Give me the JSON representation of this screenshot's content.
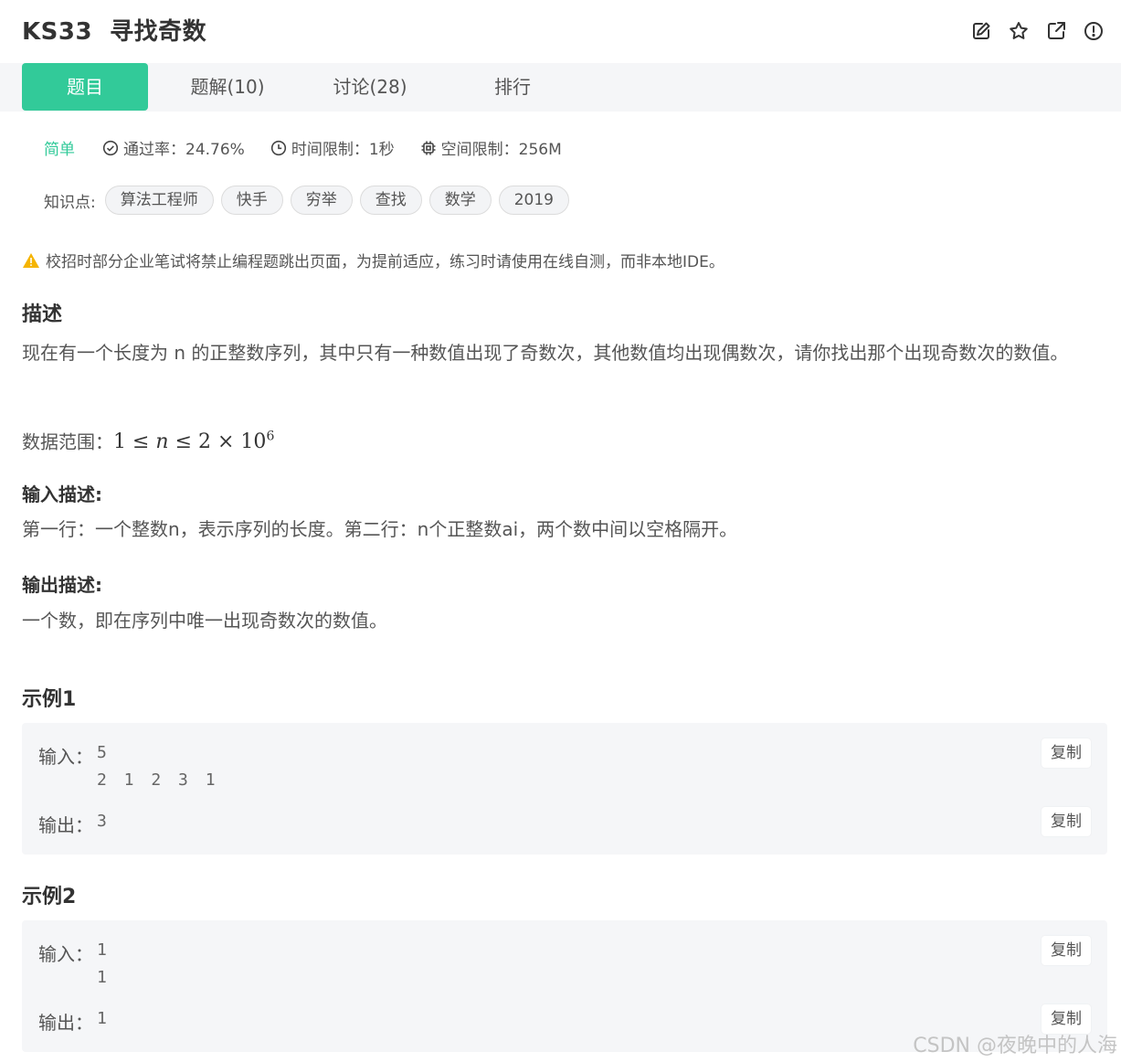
{
  "problem": {
    "title": "KS33  寻找奇数"
  },
  "tabs": [
    {
      "label": "题目",
      "active": true
    },
    {
      "label": "题解(10)"
    },
    {
      "label": "讨论(28)"
    },
    {
      "label": "排行"
    }
  ],
  "meta": {
    "difficulty": "简单",
    "pass_rate": "通过率：24.76%",
    "time_limit": "时间限制：1秒",
    "space_limit": "空间限制：256M"
  },
  "knowledge": {
    "label": "知识点:",
    "tags": [
      "算法工程师",
      "快手",
      "穷举",
      "查找",
      "数学",
      "2019"
    ]
  },
  "warning": "校招时部分企业笔试将禁止编程题跳出页面，为提前适应，练习时请使用在线自测，而非本地IDE。",
  "description": {
    "heading": "描述",
    "text": "现在有一个长度为 n 的正整数序列，其中只有一种数值出现了奇数次，其他数值均出现偶数次，请你找出那个出现奇数次的数值。",
    "range_label": "数据范围：",
    "range_formula": {
      "lhs": "1",
      "var": "n",
      "rhs": "2 × 10",
      "exp": "6"
    }
  },
  "input_desc": {
    "heading": "输入描述:",
    "text": "第一行：一个整数n，表示序列的长度。第二行：n个正整数ai，两个数中间以空格隔开。"
  },
  "output_desc": {
    "heading": "输出描述:",
    "text": "一个数，即在序列中唯一出现奇数次的数值。"
  },
  "examples": [
    {
      "heading": "示例1",
      "input_label": "输入：",
      "input_lines": [
        "5",
        "2 1 2 3 1"
      ],
      "output_label": "输出：",
      "output": "3",
      "copy_label": "复制"
    },
    {
      "heading": "示例2",
      "input_label": "输入：",
      "input_lines": [
        "1",
        "1"
      ],
      "output_label": "输出：",
      "output": "1",
      "copy_label": "复制"
    }
  ],
  "watermark": "CSDN @夜晚中的人海",
  "colors": {
    "accent": "#32ca99",
    "warning": "#f5b400"
  }
}
